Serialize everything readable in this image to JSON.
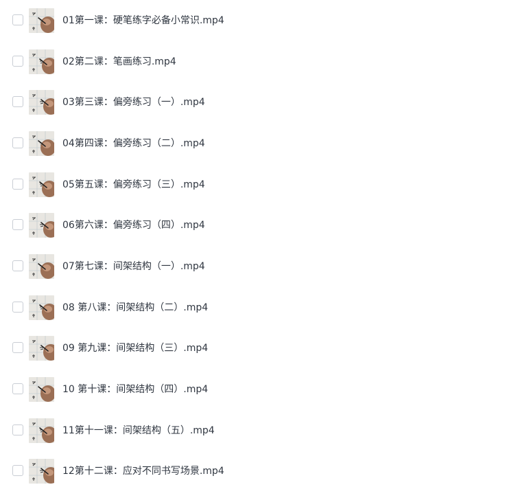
{
  "files": [
    {
      "name": "01第一课：硬笔练字必备小常识.mp4",
      "thumbnail_icon": "video-thumbnail-icon"
    },
    {
      "name": "02第二课：笔画练习.mp4",
      "thumbnail_icon": "video-thumbnail-icon"
    },
    {
      "name": "03第三课：偏旁练习（一）.mp4",
      "thumbnail_icon": "video-thumbnail-icon"
    },
    {
      "name": "04第四课：偏旁练习（二）.mp4",
      "thumbnail_icon": "video-thumbnail-icon"
    },
    {
      "name": "05第五课：偏旁练习（三）.mp4",
      "thumbnail_icon": "video-thumbnail-icon"
    },
    {
      "name": "06第六课：偏旁练习（四）.mp4",
      "thumbnail_icon": "video-thumbnail-icon"
    },
    {
      "name": "07第七课：间架结构（一）.mp4",
      "thumbnail_icon": "video-thumbnail-icon"
    },
    {
      "name": "08 第八课：间架结构（二）.mp4",
      "thumbnail_icon": "video-thumbnail-icon"
    },
    {
      "name": "09 第九课：间架结构（三）.mp4",
      "thumbnail_icon": "video-thumbnail-icon"
    },
    {
      "name": "10 第十课：间架结构（四）.mp4",
      "thumbnail_icon": "video-thumbnail-icon"
    },
    {
      "name": "11第十一课：间架结构（五）.mp4",
      "thumbnail_icon": "video-thumbnail-icon"
    },
    {
      "name": "12第十二课：应对不同书写场景.mp4",
      "thumbnail_icon": "video-thumbnail-icon"
    }
  ],
  "colors": {
    "text": "#2f3640",
    "checkbox_border": "#c9cdd4",
    "background": "#ffffff"
  }
}
